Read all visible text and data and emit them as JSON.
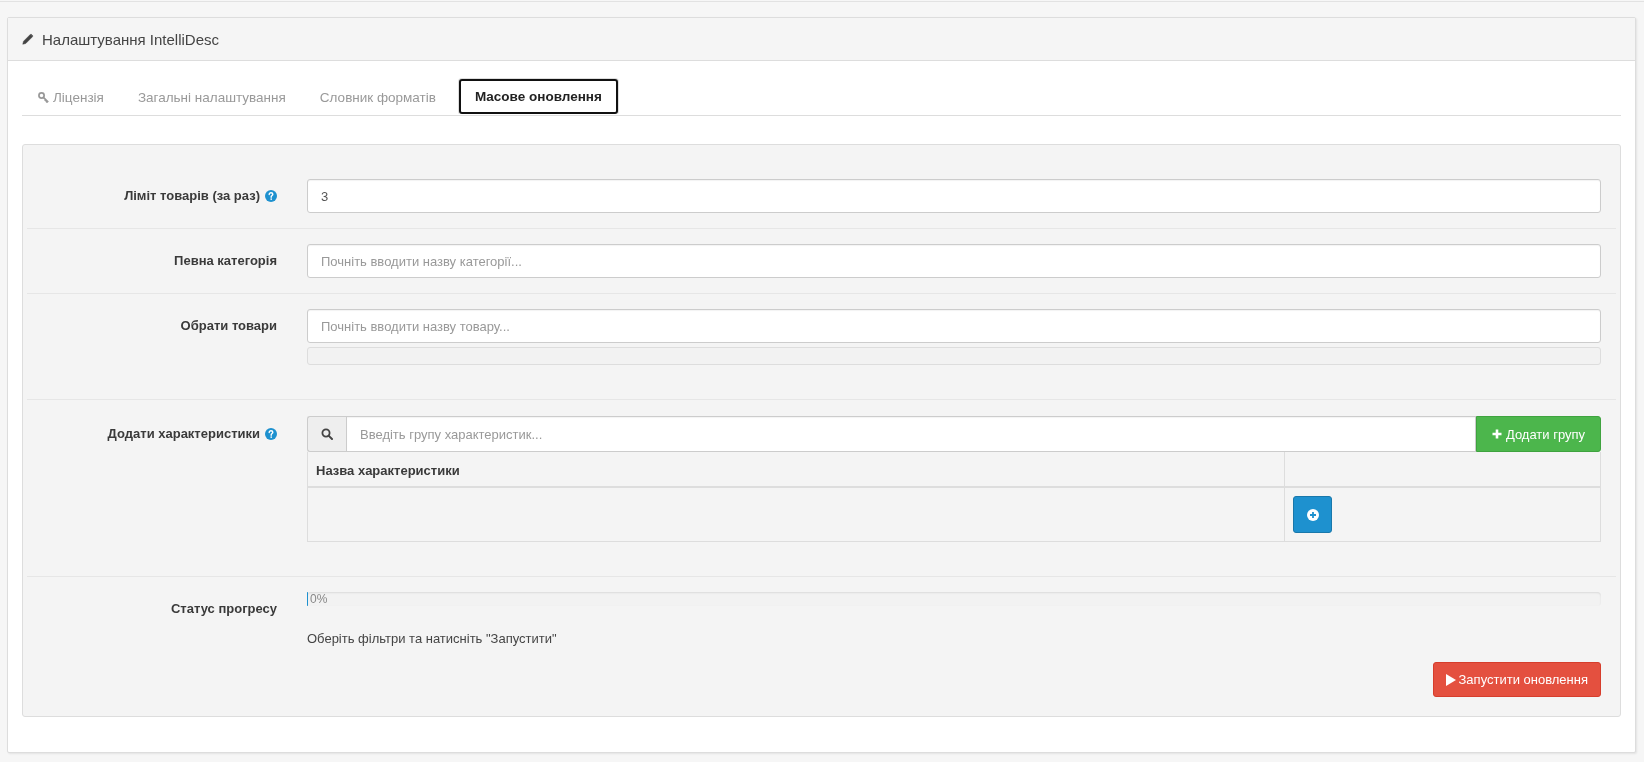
{
  "panel": {
    "title": "Налаштування IntelliDesc"
  },
  "tabs": [
    {
      "label": "Ліцензія",
      "kind": "icon",
      "selected": false
    },
    {
      "label": "Загальні налаштування",
      "kind": "text",
      "selected": false
    },
    {
      "label": "Словник форматів",
      "kind": "text",
      "selected": false
    },
    {
      "label": "Масове оновлення",
      "kind": "text",
      "selected": true
    }
  ],
  "form": [
    {
      "kind": "input",
      "label": "Ліміт товарів (за раз)",
      "help": true,
      "value": "3"
    },
    {
      "kind": "input",
      "label": "Певна категорія",
      "help": false,
      "placeholder": "Почніть вводити назву категорії..."
    },
    {
      "kind": "picker",
      "label": "Обрати товари",
      "help": false,
      "placeholder": "Почніть вводити назву товару..."
    },
    {
      "kind": "attributes",
      "label": "Додати характеристики",
      "help": true,
      "placeholder": "Введіть групу характеристик...",
      "add_button": "Додати групу",
      "columns": [
        "Назва характеристики"
      ]
    },
    {
      "kind": "progress",
      "label": "Статус прогресу",
      "help": false,
      "level": 0,
      "reading": "0%",
      "message": "Оберіть фільтри та натисніть \"Запустити\"",
      "run_button": "Запустити оновлення"
    }
  ]
}
